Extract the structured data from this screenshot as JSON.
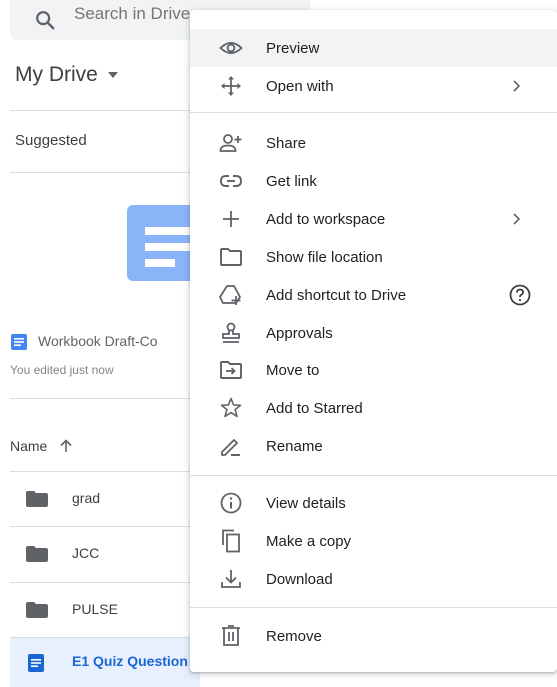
{
  "search": {
    "placeholder": "Search in Drive"
  },
  "header": {
    "title": "My Drive"
  },
  "suggested": {
    "label": "Suggested",
    "card_name": "Workbook Draft-Co",
    "card_subtitle": "You edited just now"
  },
  "files": {
    "name_header": "Name",
    "rows": [
      {
        "name": "grad",
        "kind": "folder"
      },
      {
        "name": "JCC",
        "kind": "folder"
      },
      {
        "name": "PULSE",
        "kind": "folder"
      },
      {
        "name": "E1 Quiz Question",
        "kind": "doc",
        "selected": true
      }
    ]
  },
  "context_menu": {
    "groups": [
      [
        {
          "label": "Preview",
          "icon": "eye-icon"
        },
        {
          "label": "Open with",
          "icon": "open-with-icon",
          "submenu": true
        }
      ],
      [
        {
          "label": "Share",
          "icon": "person-add-icon"
        },
        {
          "label": "Get link",
          "icon": "link-icon"
        },
        {
          "label": "Add to workspace",
          "icon": "plus-icon",
          "submenu": true
        },
        {
          "label": "Show file location",
          "icon": "folder-outline-icon"
        },
        {
          "label": "Add shortcut to Drive",
          "icon": "add-shortcut-icon",
          "help": true
        },
        {
          "label": "Approvals",
          "icon": "stamp-icon"
        },
        {
          "label": "Move to",
          "icon": "move-to-icon"
        },
        {
          "label": "Add to Starred",
          "icon": "star-outline-icon"
        },
        {
          "label": "Rename",
          "icon": "pencil-icon"
        }
      ],
      [
        {
          "label": "View details",
          "icon": "info-icon"
        },
        {
          "label": "Make a copy",
          "icon": "copy-icon"
        },
        {
          "label": "Download",
          "icon": "download-icon"
        }
      ],
      [
        {
          "label": "Remove",
          "icon": "trash-icon"
        }
      ]
    ]
  },
  "colors": {
    "accent": "#1967d2",
    "selected_row_bg": "#e8f0fe",
    "menu_highlight_bg": "#f1f3f4",
    "doc_blue": "#4285f4",
    "icon_gray": "#5f6368"
  }
}
